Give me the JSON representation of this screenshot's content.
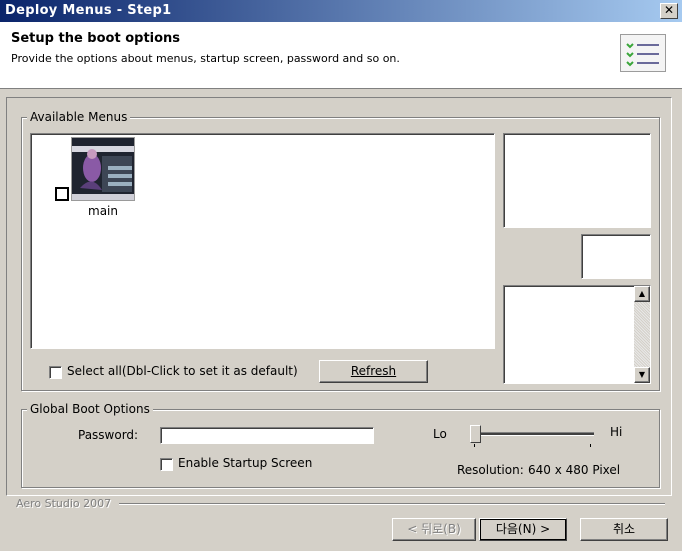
{
  "window": {
    "title": "Deploy Menus - Step1",
    "close_glyph": "✕"
  },
  "header": {
    "title": "Setup the boot options",
    "subtitle": "Provide the options about menus, startup screen, password and so on.",
    "icon": "checklist-icon"
  },
  "available_menus": {
    "legend": "Available Menus",
    "items": [
      {
        "label": "main",
        "checked": false
      }
    ],
    "select_all_label": "Select all(Dbl-Click to set it as default)",
    "refresh_label": "Refresh"
  },
  "global_boot": {
    "legend": "Global Boot Options",
    "password_label": "Password:",
    "password_value": "",
    "enable_startup_label": "Enable Startup Screen",
    "enable_startup_checked": false,
    "slider_lo": "Lo",
    "slider_hi": "Hi",
    "slider_level": 0.0,
    "resolution_label": "Resolution:",
    "resolution_value": "640 x 480 Pixel"
  },
  "footer": {
    "brand": "Aero Studio 2007",
    "back_label": "< 뒤로(B)",
    "next_label": "다음(N) >",
    "cancel_label": "취소"
  }
}
